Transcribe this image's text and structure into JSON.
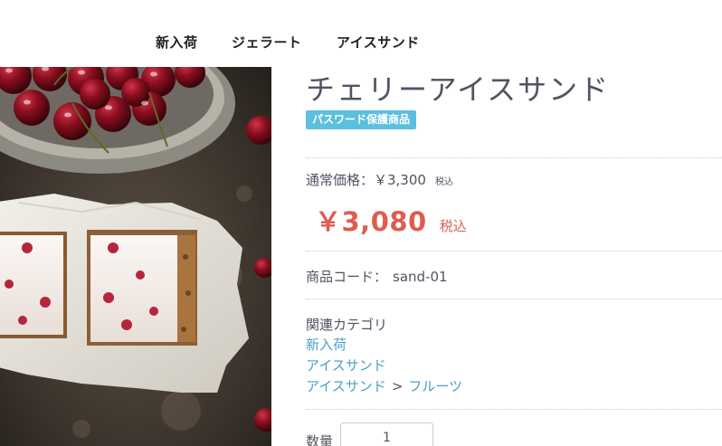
{
  "nav": {
    "items": [
      "新入荷",
      "ジェラート",
      "アイスサンド"
    ]
  },
  "product": {
    "title": "チェリーアイスサンド",
    "badge": "パスワード保護商品",
    "normal_price_label": "通常価格：￥3,300",
    "normal_price_tax": "税込",
    "sale_price": "￥3,080",
    "sale_price_tax": "税込",
    "code_label": "商品コード：",
    "code_value": "sand-01",
    "categories_heading": "関連カテゴリ",
    "categories": {
      "new": "新入荷",
      "ice_sand": "アイスサンド",
      "ice_sand_parent": "アイスサンド",
      "separator": ">",
      "fruit": "フルーツ"
    },
    "quantity_label": "数量",
    "quantity_value": "1"
  },
  "colors": {
    "accent_price": "#de5d50",
    "badge_bg": "#5bc0de",
    "link": "#4a9fc4",
    "text": "#525263"
  },
  "icons": {
    "product_image": "cherry-ice-sandwich-photo"
  }
}
